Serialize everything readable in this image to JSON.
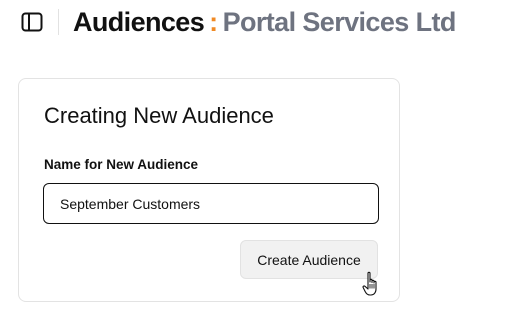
{
  "header": {
    "title_main": "Audiences",
    "title_separator": ":",
    "title_org": "Portal Services Ltd",
    "sidebar_toggle_icon": "sidebar-panel-icon"
  },
  "card": {
    "title": "Creating New Audience",
    "field_label": "Name for New Audience",
    "name_input_value": "September Customers",
    "create_button_label": "Create Audience"
  },
  "colors": {
    "accent": "#f08a24",
    "org_text": "#6e7380",
    "button_bg": "#f1f1f1"
  }
}
